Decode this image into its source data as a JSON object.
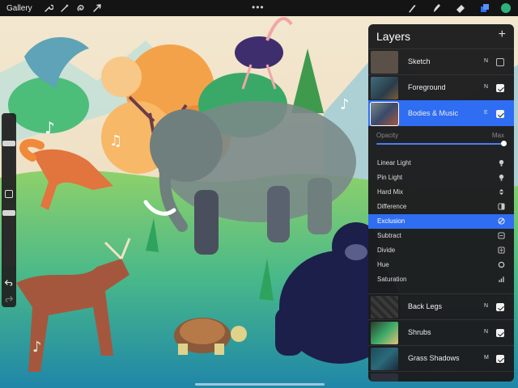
{
  "toolbar": {
    "gallery_label": "Gallery",
    "left_tools": [
      {
        "name": "wrench-icon"
      },
      {
        "name": "magic-wand-icon"
      },
      {
        "name": "selection-icon"
      },
      {
        "name": "transform-arrow-icon"
      }
    ],
    "more_label": "•••",
    "right_tools": [
      {
        "name": "brush-icon"
      },
      {
        "name": "smudge-icon"
      },
      {
        "name": "eraser-icon"
      },
      {
        "name": "layers-icon",
        "active": true
      }
    ],
    "current_color": "#2fb27a"
  },
  "layers_panel": {
    "title": "Layers",
    "add_label": "+",
    "layers_top": [
      {
        "name": "Sketch",
        "blend": "N",
        "visible": false
      },
      {
        "name": "Foreground",
        "blend": "N",
        "visible": true
      },
      {
        "name": "Bodies & Music",
        "blend": "E",
        "visible": true,
        "selected": true
      }
    ],
    "opacity_label": "Opacity",
    "opacity_max_label": "Max",
    "opacity_value": 1.0,
    "blend_modes": [
      {
        "label": "Linear Light",
        "icon": "bulb-icon"
      },
      {
        "label": "Pin Light",
        "icon": "bulb-icon"
      },
      {
        "label": "Hard Mix",
        "icon": "hard-mix-icon"
      },
      {
        "label": "Difference",
        "icon": "difference-icon"
      },
      {
        "label": "Exclusion",
        "icon": "exclusion-icon",
        "active": true
      },
      {
        "label": "Subtract",
        "icon": "minus-square-icon"
      },
      {
        "label": "Divide",
        "icon": "divide-square-icon"
      },
      {
        "label": "Hue",
        "icon": "hue-icon"
      },
      {
        "label": "Saturation",
        "icon": "saturation-icon"
      }
    ],
    "layers_bottom": [
      {
        "name": "Back Legs",
        "blend": "N",
        "visible": true
      },
      {
        "name": "Shrubs",
        "blend": "N",
        "visible": true
      },
      {
        "name": "Grass Shadows",
        "blend": "M",
        "visible": true
      }
    ]
  },
  "colors": {
    "accent": "#2f6df2",
    "panel_bg": "#1c1c1e",
    "toolbar_bg": "#141414"
  }
}
